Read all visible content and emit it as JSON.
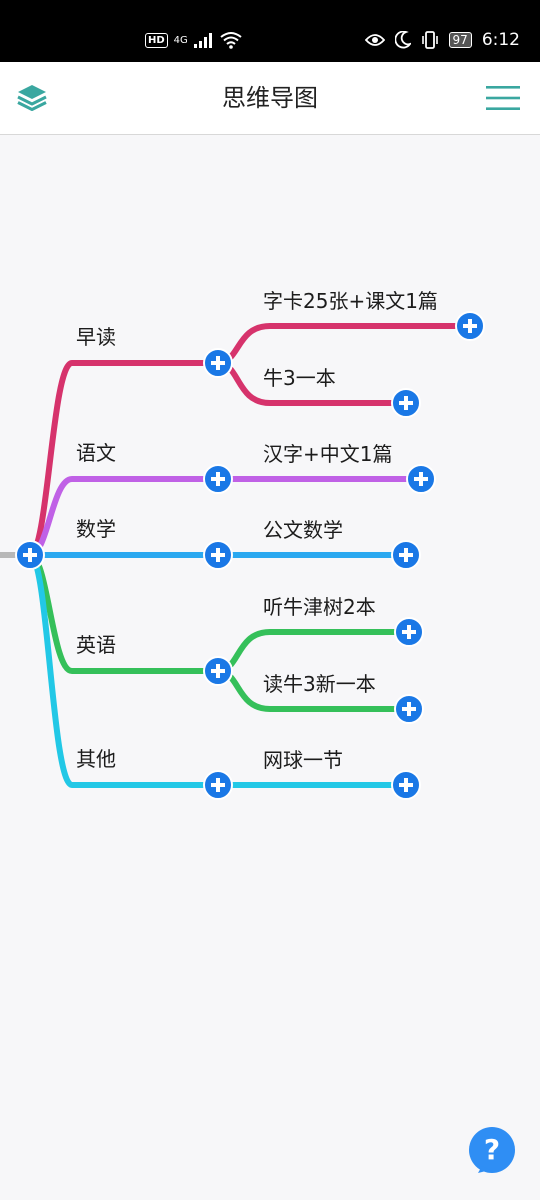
{
  "status": {
    "hd": "HD",
    "network": "4G",
    "battery": "97",
    "time": "6:12"
  },
  "header": {
    "title": "思维导图",
    "layers_icon": "layers-icon",
    "menu_icon": "hamburger-menu-icon"
  },
  "mindmap": {
    "branches": [
      {
        "label": "早读",
        "color": "#d6336c",
        "children": [
          "字卡25张+课文1篇",
          "牛3一本"
        ]
      },
      {
        "label": "语文",
        "color": "#c061e6",
        "children": [
          "汉字+中文1篇"
        ]
      },
      {
        "label": "数学",
        "color": "#2aa8f0",
        "children": [
          "公文数学"
        ]
      },
      {
        "label": "英语",
        "color": "#35c05a",
        "children": [
          "听牛津树2本",
          "读牛3新一本"
        ]
      },
      {
        "label": "其他",
        "color": "#22c8e6",
        "children": [
          "网球一节"
        ]
      }
    ]
  },
  "help": {
    "icon": "question-mark-icon",
    "label": "?"
  }
}
